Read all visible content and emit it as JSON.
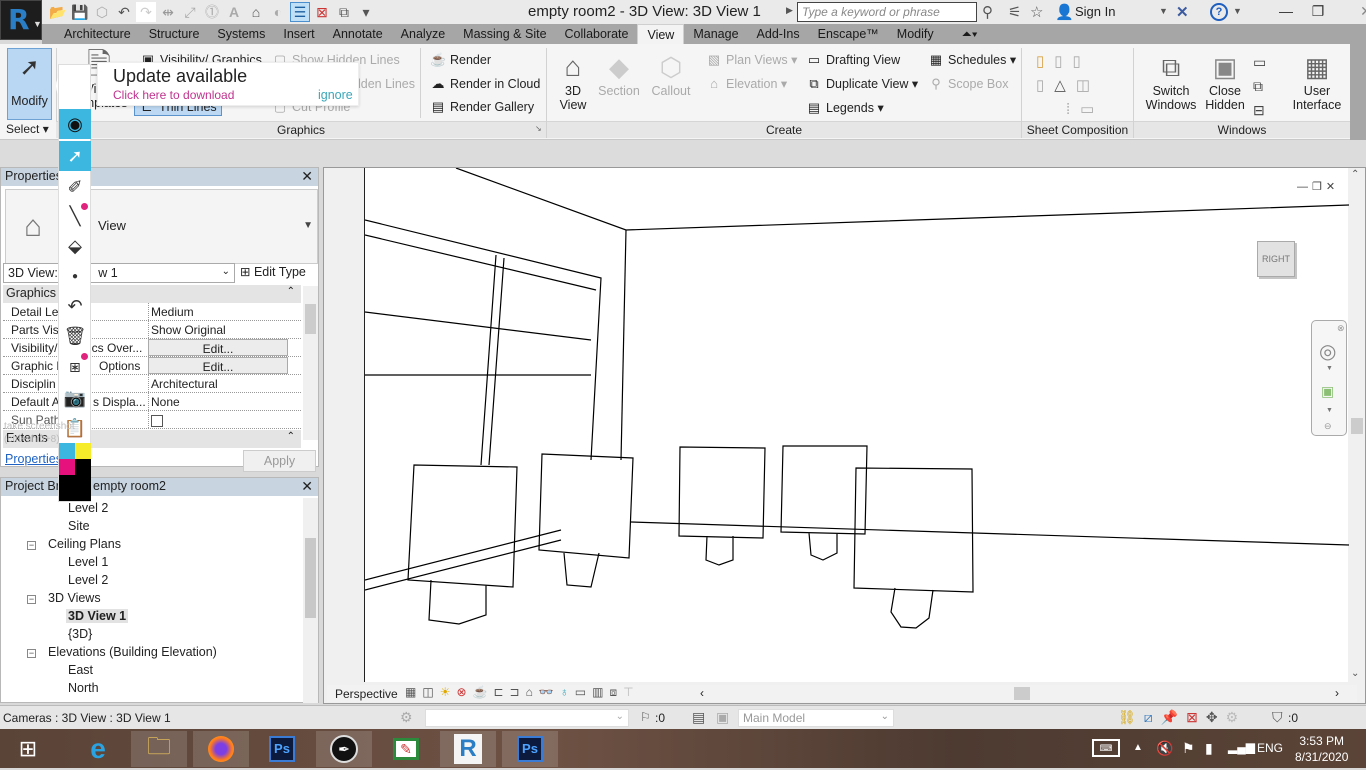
{
  "app": {
    "window_title": "empty room2 - 3D View: 3D View 1",
    "search_placeholder": "Type a keyword or phrase",
    "sign_in": "Sign In"
  },
  "ribbon_tabs": [
    "Architecture",
    "Structure",
    "Systems",
    "Insert",
    "Annotate",
    "Analyze",
    "Massing & Site",
    "Collaborate",
    "View",
    "Manage",
    "Add-Ins",
    "Enscape™",
    "Modify"
  ],
  "active_tab": "View",
  "ribbon": {
    "select": {
      "modify": "Modify",
      "select_label": "Select"
    },
    "graphics": {
      "label": "Graphics",
      "view_templates": "View Templates",
      "visibility_graphics": "Visibility/ Graphics",
      "show_hidden_lines": "Show  Hidden Lines",
      "remove_hidden_lines": "Remove Hidden Lines",
      "thin_lines": "Thin  Lines",
      "cut_profile": "Cut  Profile",
      "render": "Render",
      "render_in_cloud": "Render  in Cloud",
      "render_gallery": "Render  Gallery"
    },
    "create": {
      "label": "Create",
      "view_3d": "3D View",
      "view_3d_l1": "3D",
      "view_3d_l2": "View",
      "section": "Section",
      "callout": "Callout",
      "plan_views": "Plan  Views",
      "elevation": "Elevation",
      "drafting_view": "Drafting  View",
      "duplicate_view": "Duplicate  View",
      "legends": "Legends",
      "schedules": "Schedules",
      "scope_box": "Scope  Box"
    },
    "sheet_composition": {
      "label": "Sheet Composition"
    },
    "windows": {
      "label": "Windows",
      "switch_l1": "Switch",
      "switch_l2": "Windows",
      "close_l1": "Close",
      "close_l2": "Hidden",
      "ui_l1": "User",
      "ui_l2": "Interface"
    }
  },
  "update_toast": {
    "title": "Update available",
    "link": "Click here to download",
    "ignore": "ignore"
  },
  "properties": {
    "title": "Properties",
    "type_name": "3D View",
    "type_name_visible": "View",
    "view_selector": "3D View: 3D View 1",
    "view_selector_visible_a": "3D View: 3",
    "view_selector_visible_b": "w 1",
    "edit_type": "Edit Type",
    "sections": {
      "graphics": "Graphics",
      "extents": "Extents"
    },
    "rows": [
      {
        "key": "Detail Lev",
        "value": "Medium"
      },
      {
        "key": "Parts Visi",
        "value": "Show Original"
      },
      {
        "key": "Visibility/",
        "key2": "ics Over...",
        "value": "Edit..."
      },
      {
        "key": "Graphic D",
        "key2": "Options",
        "value": "Edit..."
      },
      {
        "key": "Disciplin",
        "value": "Architectural"
      },
      {
        "key": "Default A",
        "key2": "s Displa...",
        "value": "None"
      },
      {
        "key": "Sun Path",
        "value": ""
      }
    ],
    "help_link": "Properties",
    "apply": "Apply",
    "tooltip_ghost": "take screenshot (ctrl+shift+8)"
  },
  "project_browser": {
    "title": "Project Bro",
    "title_rest": "empty room2",
    "items": [
      {
        "label": "Level 2",
        "level": 2
      },
      {
        "label": "Site",
        "level": 2
      },
      {
        "label": "Ceiling Plans",
        "level": 1
      },
      {
        "label": "Level 1",
        "level": 2
      },
      {
        "label": "Level 2",
        "level": 2
      },
      {
        "label": "3D Views",
        "level": 1
      },
      {
        "label": "3D View 1",
        "level": 2,
        "selected": true
      },
      {
        "label": "{3D}",
        "level": 2
      },
      {
        "label": "Elevations (Building Elevation)",
        "level": 1
      },
      {
        "label": "East",
        "level": 2
      },
      {
        "label": "North",
        "level": 2
      }
    ]
  },
  "view": {
    "viewcube": "RIGHT",
    "view_mode": "Perspective"
  },
  "statusbar": {
    "message": "Cameras : 3D View : 3D View 1",
    "selection_count": ":0",
    "model": "Main Model",
    "filter_count": ":0"
  },
  "taskbar": {
    "apps": [
      "start",
      "internet-explorer",
      "file-explorer",
      "firefox",
      "photoshop",
      "epic-pen",
      "whiteboard",
      "revit",
      "photoshop-2"
    ],
    "language": "ENG",
    "time": "3:53 PM",
    "date": "8/31/2020"
  },
  "colors": {
    "accent": "#3cb8e0",
    "revit_blue": "#2a7ec5",
    "link_magenta": "#c0338f",
    "ignore_teal": "#3aa6b9"
  }
}
